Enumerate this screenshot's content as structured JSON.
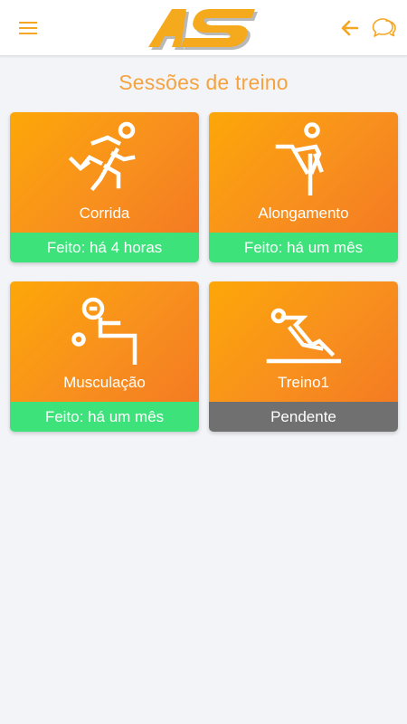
{
  "header": {
    "menu_icon": "hamburger-menu-icon",
    "logo_text": "AS",
    "back_icon": "arrow-left-icon",
    "chat_icon": "chat-bubbles-icon",
    "accent_color": "#f5a623"
  },
  "page": {
    "title": "Sessões de treino"
  },
  "sessions": [
    {
      "label": "Corrida",
      "status": "Feito: há 4 horas",
      "status_type": "done",
      "icon": "running-person-icon"
    },
    {
      "label": "Alongamento",
      "status": "Feito: há um mês",
      "status_type": "done",
      "icon": "stretching-person-icon"
    },
    {
      "label": "Musculação",
      "status": "Feito: há um mês",
      "status_type": "done",
      "icon": "weightlifting-person-icon"
    },
    {
      "label": "Treino1",
      "status": "Pendente",
      "status_type": "pending",
      "icon": "situp-person-icon"
    }
  ],
  "colors": {
    "card_gradient_start": "#fda708",
    "card_gradient_end": "#f47b22",
    "status_done": "#3de27b",
    "status_pending": "#707070",
    "background": "#f3f4f8"
  }
}
